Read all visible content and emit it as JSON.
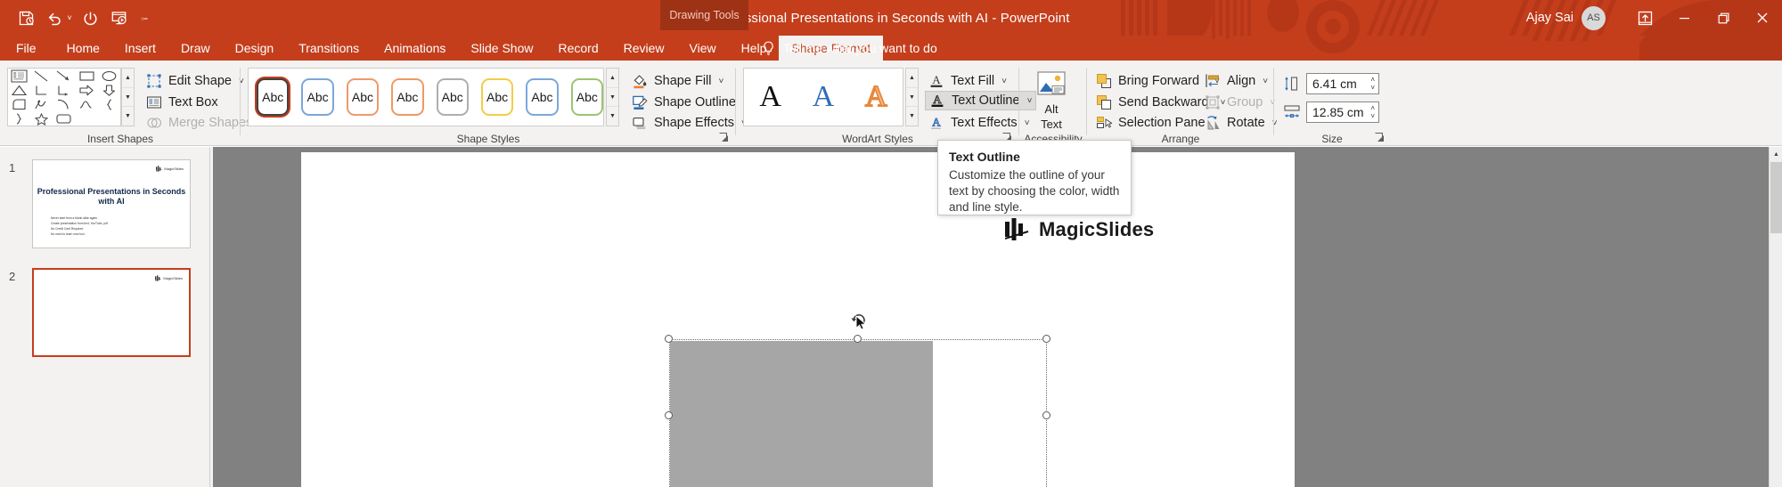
{
  "titlebar": {
    "document_title": "Professional Presentations in Seconds with AI  -  PowerPoint",
    "contextual_tab": "Drawing Tools",
    "user_name": "Ajay Sai",
    "user_initials": "AS",
    "qat": [
      {
        "name": "save-icon",
        "label": "Save"
      },
      {
        "name": "undo-icon",
        "label": "Undo"
      },
      {
        "name": "redo-icon",
        "label": "Redo"
      },
      {
        "name": "start-from-beginning-icon",
        "label": "Start From Beginning"
      },
      {
        "name": "customize-qat-icon",
        "label": "Customize Quick Access Toolbar"
      }
    ],
    "window_controls": [
      {
        "name": "ribbon-display-options-icon",
        "label": "Ribbon Display Options"
      },
      {
        "name": "minimize-icon",
        "label": "Minimize"
      },
      {
        "name": "restore-icon",
        "label": "Restore Down"
      },
      {
        "name": "close-icon",
        "label": "Close"
      }
    ],
    "accent_color": "#C43E1C",
    "contextual_tab_color": "#9E3215"
  },
  "tabs": [
    {
      "label": "File",
      "active": false
    },
    {
      "label": "Home",
      "active": false
    },
    {
      "label": "Insert",
      "active": false
    },
    {
      "label": "Draw",
      "active": false
    },
    {
      "label": "Design",
      "active": false
    },
    {
      "label": "Transitions",
      "active": false
    },
    {
      "label": "Animations",
      "active": false
    },
    {
      "label": "Slide Show",
      "active": false
    },
    {
      "label": "Record",
      "active": false
    },
    {
      "label": "Review",
      "active": false
    },
    {
      "label": "View",
      "active": false
    },
    {
      "label": "Help",
      "active": false
    },
    {
      "label": "Shape Format",
      "active": true
    }
  ],
  "tell_me": {
    "placeholder": "Tell me what you want to do"
  },
  "ribbon": {
    "groups": [
      {
        "name": "insert-shapes",
        "label": "Insert Shapes"
      },
      {
        "name": "shape-styles",
        "label": "Shape Styles"
      },
      {
        "name": "wordart-styles",
        "label": "WordArt Styles"
      },
      {
        "name": "accessibility",
        "label": "Accessibility"
      },
      {
        "name": "arrange",
        "label": "Arrange"
      },
      {
        "name": "size",
        "label": "Size"
      }
    ],
    "insert_shapes": {
      "buttons": [
        {
          "label": "Edit Shape",
          "icon": "edit-shape-icon",
          "disabled": false,
          "caret": true
        },
        {
          "label": "Text Box",
          "icon": "text-box-icon",
          "disabled": false,
          "caret": false
        },
        {
          "label": "Merge Shapes",
          "icon": "merge-shapes-icon",
          "disabled": true,
          "caret": true
        }
      ],
      "shape_icons": [
        "textbox-shape",
        "line-shape",
        "line-arrow-shape",
        "rectangle-shape",
        "oval-shape",
        "rounded-rectangle-shape",
        "triangle-shape",
        "elbow-connector-shape",
        "elbow-arrow-connector-shape",
        "right-arrow-shape",
        "down-arrow-shape",
        "pie-shape",
        "scribble-shape",
        "arc-shape",
        "curve-shape",
        "left-brace-shape",
        "right-brace-shape",
        "star-shape"
      ]
    },
    "shape_styles": {
      "swatches": [
        {
          "label": "Abc",
          "border": "#404040",
          "selected": true
        },
        {
          "label": "Abc",
          "border": "#7CA6D8",
          "selected": false
        },
        {
          "label": "Abc",
          "border": "#EE9A6B",
          "selected": false
        },
        {
          "label": "Abc",
          "border": "#ED9A63",
          "selected": false
        },
        {
          "label": "Abc",
          "border": "#B0AEAC",
          "selected": false
        },
        {
          "label": "Abc",
          "border": "#F4CC4A",
          "selected": false
        },
        {
          "label": "Abc",
          "border": "#7BA7DC",
          "selected": false
        },
        {
          "label": "Abc",
          "border": "#9CC473",
          "selected": false
        }
      ],
      "buttons": [
        {
          "label": "Shape Fill",
          "icon": "shape-fill-icon",
          "caret": true
        },
        {
          "label": "Shape Outline",
          "icon": "shape-outline-icon",
          "caret": true
        },
        {
          "label": "Shape Effects",
          "icon": "shape-effects-icon",
          "caret": true
        }
      ]
    },
    "wordart_styles": {
      "swatches": [
        {
          "label": "A",
          "color": "#111111",
          "style": "solid"
        },
        {
          "label": "A",
          "color": "#2E6DB4",
          "style": "solid"
        },
        {
          "label": "A",
          "color": "#E8883A",
          "style": "outline"
        }
      ],
      "buttons": [
        {
          "label": "Text Fill",
          "icon": "text-fill-icon",
          "caret": true,
          "hover": false
        },
        {
          "label": "Text Outline",
          "icon": "text-outline-icon",
          "caret": true,
          "hover": true
        },
        {
          "label": "Text Effects",
          "icon": "text-effects-icon",
          "caret": true,
          "hover": false
        }
      ]
    },
    "accessibility": {
      "alt_text_label_line1": "Alt",
      "alt_text_label_line2": "Text",
      "icon": "alt-text-picture-icon"
    },
    "arrange": {
      "buttons": [
        {
          "label": "Bring Forward",
          "icon": "bring-forward-icon",
          "caret": true,
          "disabled": false
        },
        {
          "label": "Send Backward",
          "icon": "send-backward-icon",
          "caret": true,
          "disabled": false
        },
        {
          "label": "Selection Pane",
          "icon": "selection-pane-icon",
          "caret": false,
          "disabled": false
        },
        {
          "label": "Align",
          "icon": "align-icon",
          "caret": true,
          "disabled": false
        },
        {
          "label": "Group",
          "icon": "group-icon",
          "caret": true,
          "disabled": true
        },
        {
          "label": "Rotate",
          "icon": "rotate-icon",
          "caret": true,
          "disabled": false
        }
      ]
    },
    "size": {
      "height": {
        "value": "6.41 cm",
        "icon": "shape-height-icon"
      },
      "width": {
        "value": "12.85 cm",
        "icon": "shape-width-icon"
      }
    }
  },
  "tooltip": {
    "title": "Text Outline",
    "body": "Customize the outline of your text by choosing the color, width and line style."
  },
  "slide_panel": {
    "slides": [
      {
        "number": "1",
        "selected": false,
        "title": "Professional Presentations in Seconds with AI",
        "bullets": [
          "Never start from a blank slide again.",
          "Create presentation from text, YouTube, pdf",
          "No Credit Card Required",
          "No need to learn new tool"
        ],
        "logo_text": "MagicSlides"
      },
      {
        "number": "2",
        "selected": true,
        "title": "",
        "bullets": [],
        "logo_text": "MagicSlides"
      }
    ]
  },
  "canvas": {
    "logo_text": "MagicSlides",
    "selection": {
      "name": "selected-shape",
      "handles": [
        "top-left",
        "top-center",
        "top-right",
        "middle-left",
        "middle-right"
      ],
      "rotation_handle": "rotate-handle",
      "fill_color": "#A6A6A6"
    }
  },
  "scrollbar": {
    "up_label": "▲",
    "down_label": "▼"
  }
}
